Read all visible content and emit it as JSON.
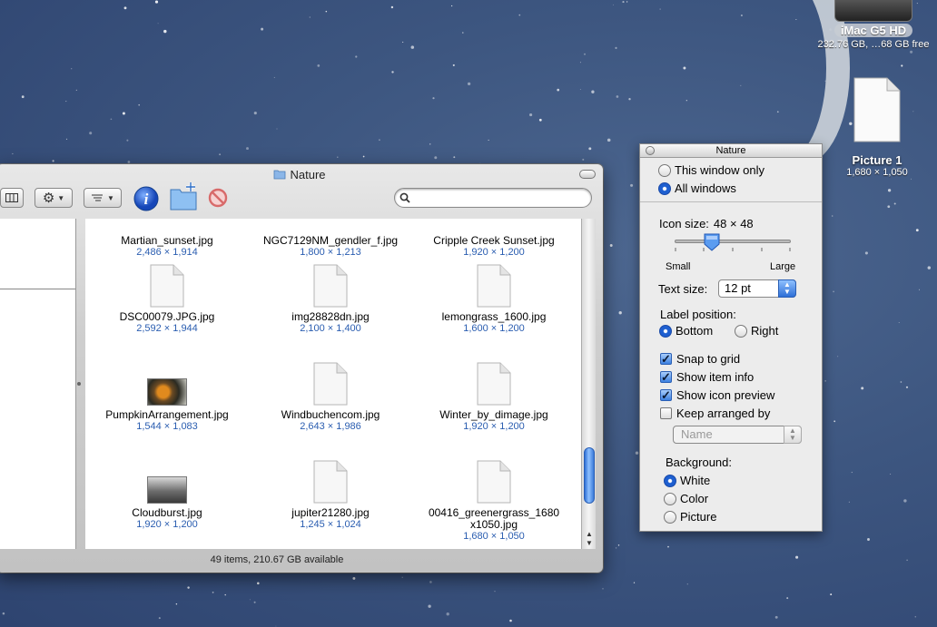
{
  "desktop": {
    "hd": {
      "label": "iMac G5 HD",
      "info": "232.76 GB, …68 GB free"
    },
    "picture": {
      "label": "Picture 1",
      "info": "1,680 × 1,050"
    }
  },
  "finder": {
    "title": "Nature",
    "search_placeholder": "",
    "status": "49 items, 210.67 GB available",
    "files": [
      {
        "name": "Martian_sunset.jpg",
        "dims": "2,486 × 1,914",
        "thumb": "none"
      },
      {
        "name": "NGC7129NM_gendler_f.jpg",
        "dims": "1,800 × 1,213",
        "thumb": "none"
      },
      {
        "name": "Cripple Creek Sunset.jpg",
        "dims": "1,920 × 1,200",
        "thumb": "none"
      },
      {
        "name": "DSC00079.JPG.jpg",
        "dims": "2,592 × 1,944",
        "thumb": "doc"
      },
      {
        "name": "img28828dn.jpg",
        "dims": "2,100 × 1,400",
        "thumb": "doc"
      },
      {
        "name": "lemongrass_1600.jpg",
        "dims": "1,600 × 1,200",
        "thumb": "doc"
      },
      {
        "name": "PumpkinArrangement.jpg",
        "dims": "1,544 × 1,083",
        "thumb": "photo-pumpkin"
      },
      {
        "name": "Windbuchencom.jpg",
        "dims": "2,643 × 1,986",
        "thumb": "doc"
      },
      {
        "name": "Winter_by_dimage.jpg",
        "dims": "1,920 × 1,200",
        "thumb": "doc"
      },
      {
        "name": "Cloudburst.jpg",
        "dims": "1,920 × 1,200",
        "thumb": "photo-cloud"
      },
      {
        "name": "jupiter21280.jpg",
        "dims": "1,245 × 1,024",
        "thumb": "doc"
      },
      {
        "name": "00416_greenergrass_1680\nx1050.jpg",
        "dims": "1,680 × 1,050",
        "thumb": "doc"
      }
    ]
  },
  "view_options": {
    "title": "Nature",
    "scope_this": "This window only",
    "scope_all": "All windows",
    "icon_size_label": "Icon size:",
    "icon_size_value": "48 × 48",
    "icon_size_fraction": 0.32,
    "small_label": "Small",
    "large_label": "Large",
    "text_size_label": "Text size:",
    "text_size_value": "12 pt",
    "label_position_label": "Label position:",
    "label_bottom": "Bottom",
    "label_right": "Right",
    "snap_to_grid": "Snap to grid",
    "show_item_info": "Show item info",
    "show_icon_preview": "Show icon preview",
    "keep_arranged_by": "Keep arranged by",
    "arrange_value": "Name",
    "background_label": "Background:",
    "bg_white": "White",
    "bg_color": "Color",
    "bg_picture": "Picture"
  }
}
